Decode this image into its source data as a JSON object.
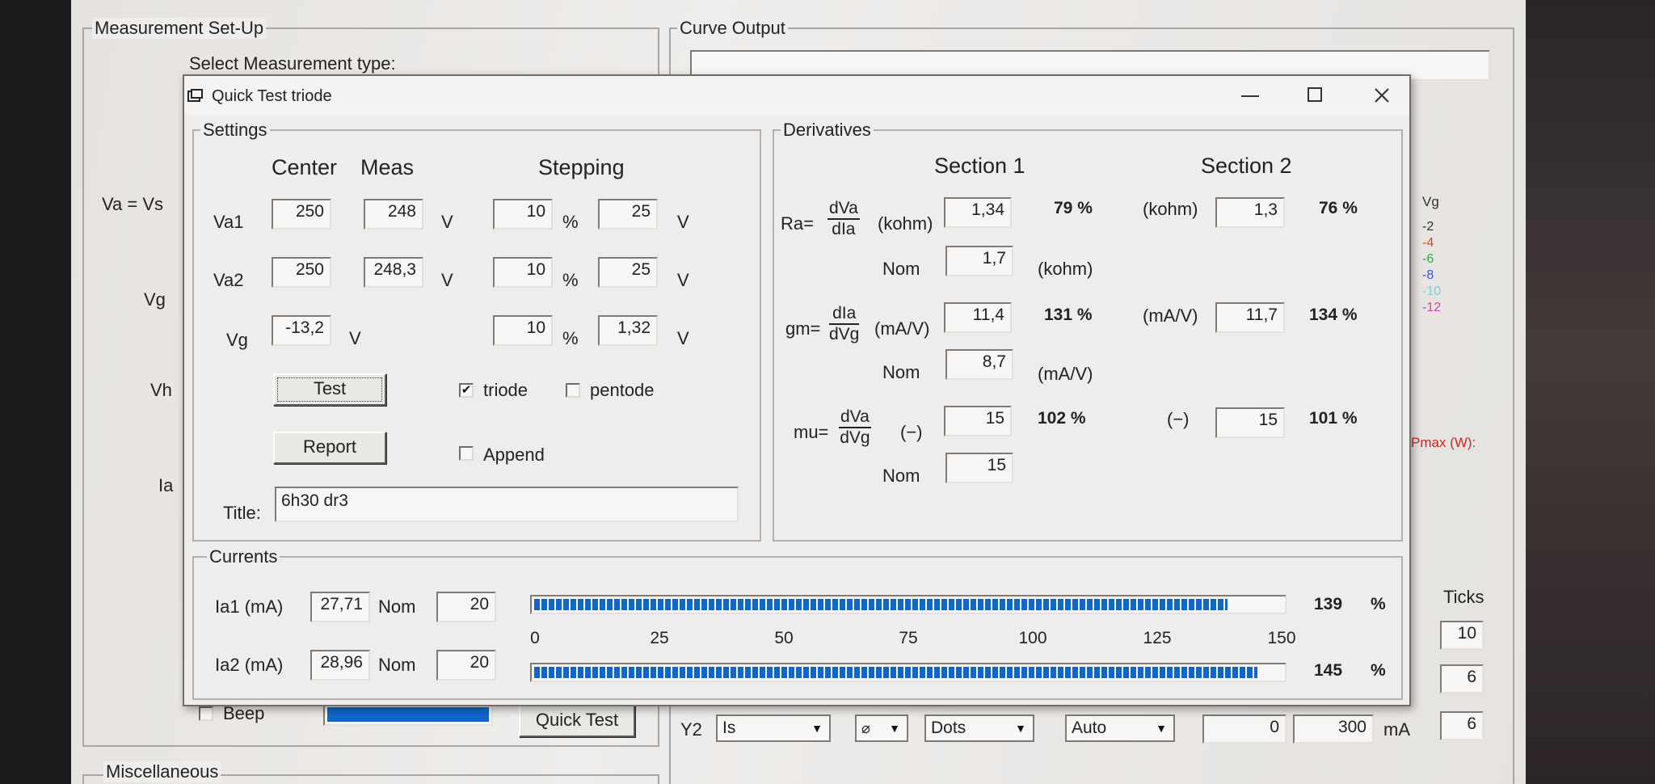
{
  "background": {
    "measurement_setup": {
      "title": "Measurement Set-Up",
      "select_type_label": "Select Measurement type:",
      "va_vs_label": "Va = Vs",
      "vg_label": "Vg",
      "vh_label": "Vh",
      "ia_label": "Ia",
      "beep_label": "Beep",
      "quick_test_button": "Quick Test",
      "progress_fraction": 1.0
    },
    "miscellaneous": {
      "title": "Miscellaneous"
    },
    "curve_output": {
      "title": "Curve Output",
      "legend_title": "Vg",
      "legend": [
        {
          "label": "-2",
          "color": "#2c2c2c"
        },
        {
          "label": "-4",
          "color": "#d9452b"
        },
        {
          "label": "-6",
          "color": "#38a648"
        },
        {
          "label": "-8",
          "color": "#2f56d8"
        },
        {
          "label": "-10",
          "color": "#7ad0e0"
        },
        {
          "label": "-12",
          "color": "#c24aa8"
        }
      ],
      "pmax_label": "Pmax (W):",
      "pmax_color": "#c8281e",
      "ticks_label": "Ticks",
      "ticks_values": [
        "10",
        "6",
        "6"
      ],
      "y2_label": "Y2",
      "y2_combo": "Is",
      "style_combo": "Dots",
      "scale_combo": "Auto",
      "min_value": "0",
      "max_value": "300",
      "unit": "mA"
    }
  },
  "dialog": {
    "title": "Quick Test triode",
    "settings": {
      "title": "Settings",
      "col_center": "Center",
      "col_meas": "Meas",
      "col_stepping": "Stepping",
      "rows": [
        {
          "label": "Va1",
          "center": "250",
          "meas": "248",
          "unit": "V",
          "step_pct": "10",
          "pct_sign": "%",
          "step_val": "25",
          "step_unit": "V"
        },
        {
          "label": "Va2",
          "center": "250",
          "meas": "248,3",
          "unit": "V",
          "step_pct": "10",
          "pct_sign": "%",
          "step_val": "25",
          "step_unit": "V"
        },
        {
          "label": "Vg",
          "center": "-13,2",
          "unit": "V",
          "step_pct": "10",
          "pct_sign": "%",
          "step_val": "1,32",
          "step_unit": "V"
        }
      ],
      "test_button": "Test",
      "report_button": "Report",
      "triode_label": "triode",
      "triode_checked": "✔",
      "pentode_label": "pentode",
      "append_label": "Append",
      "title_label": "Title:",
      "title_value": "6h30 dr3"
    },
    "derivatives": {
      "title": "Derivatives",
      "section1": "Section 1",
      "section2": "Section 2",
      "ra": {
        "prefix": "Ra=",
        "num": "dVa",
        "den": "dIa",
        "unit": "(kohm)",
        "s1_value": "1,34",
        "s1_pct": "79 %",
        "s2_unit": "(kohm)",
        "s2_value": "1,3",
        "s2_pct": "76 %",
        "nom_label": "Nom",
        "nom_value": "1,7",
        "nom_unit": "(kohm)"
      },
      "gm": {
        "prefix": "gm=",
        "num": "dIa",
        "den": "dVg",
        "unit": "(mA/V)",
        "s1_value": "11,4",
        "s1_pct": "131 %",
        "s2_unit": "(mA/V)",
        "s2_value": "11,7",
        "s2_pct": "134 %",
        "nom_label": "Nom",
        "nom_value": "8,7",
        "nom_unit": "(mA/V)"
      },
      "mu": {
        "prefix": "mu=",
        "num": "dVa",
        "den": "dVg",
        "unit": "(−)",
        "s1_value": "15",
        "s1_pct": "102 %",
        "s2_unit": "(−)",
        "s2_value": "15",
        "s2_pct": "101 %",
        "nom_label": "Nom",
        "nom_value": "15"
      }
    },
    "currents": {
      "title": "Currents",
      "ia1": {
        "label": "Ia1 (mA)",
        "value": "27,71",
        "nom_label": "Nom",
        "nom_value": "20",
        "pct_value": "139",
        "pct_sign": "%",
        "fraction": 0.9267
      },
      "ia2": {
        "label": "Ia2 (mA)",
        "value": "28,96",
        "nom_label": "Nom",
        "nom_value": "20",
        "pct_value": "145",
        "pct_sign": "%",
        "fraction": 0.9667
      },
      "scale_ticks": [
        "0",
        "25",
        "50",
        "75",
        "100",
        "125",
        "150"
      ],
      "scale_max": 150
    }
  }
}
